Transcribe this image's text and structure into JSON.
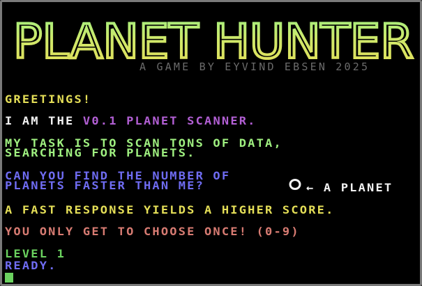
{
  "title": "PLANET HUNTER",
  "credits": "A GAME BY EYVIND EBSEN 2025",
  "lines": {
    "greetings": "GREETINGS!",
    "iam_prefix": "I AM THE ",
    "iam_version": "V0.1 PLANET SCANNER.",
    "task_1": "MY TASK IS TO SCAN TONS OF DATA,",
    "task_2": "SEARCHING FOR PLANETS.",
    "find_1": "CAN YOU FIND THE NUMBER OF",
    "find_2": "PLANETS FASTER THAN ME?",
    "legend": "← A PLANET",
    "fast": "A FAST RESPONSE YIELDS A HIGHER SCORE.",
    "once": "YOU ONLY GET TO CHOOSE ONCE! (0-9)",
    "level": "LEVEL 1",
    "ready": "READY."
  },
  "icons": {
    "planet": "planet-circle-icon",
    "cursor": "block-cursor"
  },
  "colors": {
    "background": "#000000",
    "border": "#7a7a7a",
    "logo_yellow": "#e4de57",
    "logo_green": "#9ff080",
    "yellow": "#e4de57",
    "white": "#f2f2f2",
    "purple": "#b25fd4",
    "light_green": "#9ff080",
    "blue": "#6f6cf2",
    "red": "#d77b72",
    "green": "#6bd25f",
    "grey": "#6b6b6b"
  }
}
